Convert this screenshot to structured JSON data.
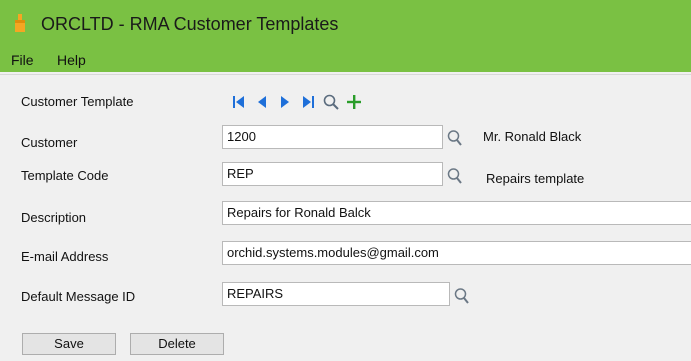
{
  "window": {
    "title": "ORCLTD - RMA Customer Templates"
  },
  "menu": {
    "file": "File",
    "help": "Help"
  },
  "form": {
    "customer_template": {
      "label": "Customer Template"
    },
    "customer": {
      "label": "Customer",
      "value": "1200",
      "description": "Mr. Ronald Black"
    },
    "template_code": {
      "label": "Template Code",
      "value": "REP",
      "description": "Repairs template"
    },
    "description": {
      "label": "Description",
      "value": "Repairs for Ronald Balck"
    },
    "email": {
      "label": "E-mail Address",
      "value": "orchid.systems.modules@gmail.com"
    },
    "default_message": {
      "label": "Default Message ID",
      "value": "REPAIRS"
    }
  },
  "buttons": {
    "save": "Save",
    "delete": "Delete"
  },
  "icons": {
    "app": "app-icon",
    "first": "first-record-icon",
    "previous": "previous-record-icon",
    "next": "next-record-icon",
    "last": "last-record-icon",
    "finder": "search-icon",
    "new": "add-icon"
  },
  "colors": {
    "titlebar": "#7ac143",
    "nav_blue": "#1e6fd9",
    "add_green": "#2a9d2a"
  }
}
